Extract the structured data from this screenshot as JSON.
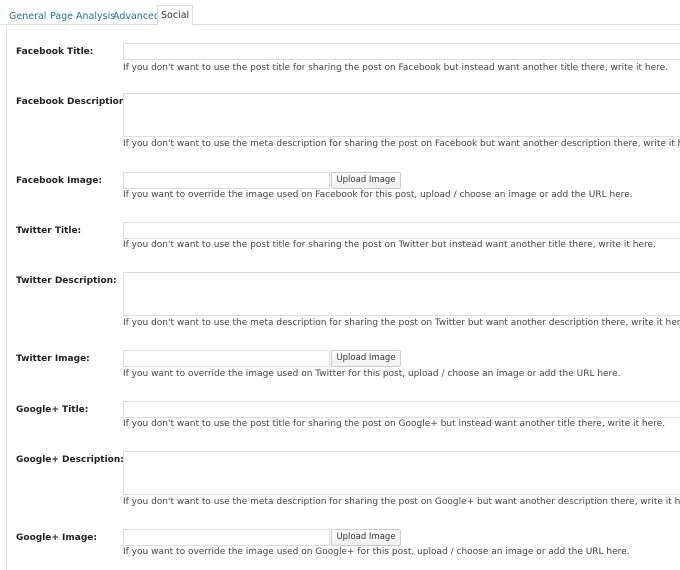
{
  "tabs": [
    {
      "label": "General"
    },
    {
      "label": "Page Analysis"
    },
    {
      "label": "Advanced"
    },
    {
      "label": "Social"
    }
  ],
  "fields": {
    "facebook_title": {
      "label": "Facebook Title:",
      "value": "",
      "description": "If you don't want to use the post title for sharing the post on Facebook but instead want another title there, write it here."
    },
    "facebook_description": {
      "label": "Facebook Description:",
      "value": "",
      "description": "If you don't want to use the meta description for sharing the post on Facebook but want another description there, write it here."
    },
    "facebook_image": {
      "label": "Facebook Image:",
      "value": "",
      "button": "Upload Image",
      "description": "If you want to override the image used on Facebook for this post, upload / choose an image or add the URL here."
    },
    "twitter_title": {
      "label": "Twitter Title:",
      "value": "",
      "description": "If you don't want to use the post title for sharing the post on Twitter but instead want another title there, write it here."
    },
    "twitter_description": {
      "label": "Twitter Description:",
      "value": "",
      "description": "If you don't want to use the meta description for sharing the post on Twitter but want another description there, write it here."
    },
    "twitter_image": {
      "label": "Twitter Image:",
      "value": "",
      "button": "Upload Image",
      "description": "If you want to override the image used on Twitter for this post, upload / choose an image or add the URL here."
    },
    "google_title": {
      "label": "Google+ Title:",
      "value": "",
      "description": "If you don't want to use the post title for sharing the post on Google+ but instead want another title there, write it here."
    },
    "google_description": {
      "label": "Google+ Description:",
      "value": "",
      "description": "If you don't want to use the meta description for sharing the post on Google+ but want another description there, write it here."
    },
    "google_image": {
      "label": "Google+ Image:",
      "value": "",
      "button": "Upload Image",
      "description": "If you want to override the image used on Google+ for this post, upload / choose an image or add the URL here."
    }
  },
  "colors": {
    "tab_link": "#21759b",
    "border": "#dfdfdf",
    "label": "#222222",
    "text": "#444444"
  }
}
